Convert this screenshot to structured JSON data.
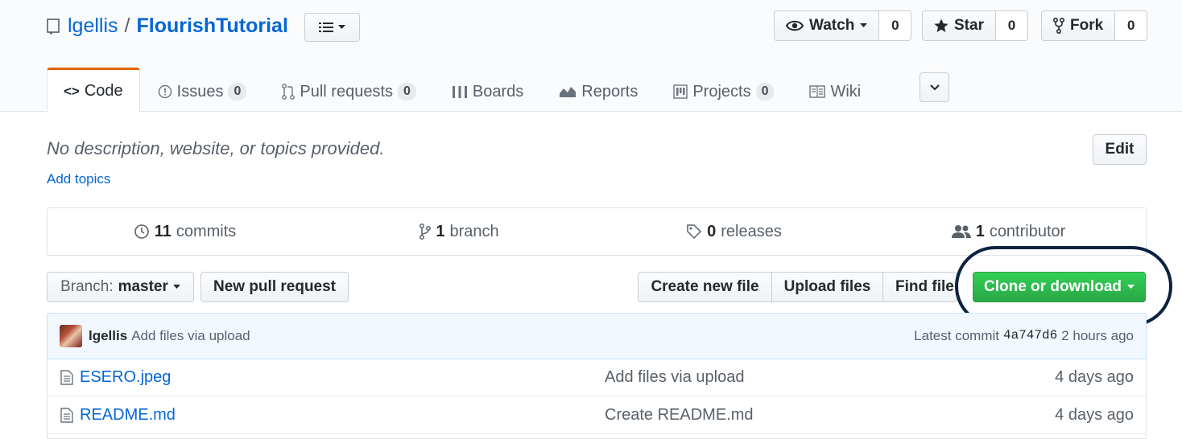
{
  "repo": {
    "owner": "lgellis",
    "separator": "/",
    "name": "FlourishTutorial"
  },
  "actions": {
    "watch": {
      "label": "Watch",
      "count": "0"
    },
    "star": {
      "label": "Star",
      "count": "0"
    },
    "fork": {
      "label": "Fork",
      "count": "0"
    }
  },
  "tabs": [
    {
      "label": "Code",
      "icon": "code-icon"
    },
    {
      "label": "Issues",
      "count": "0",
      "icon": "issue-icon"
    },
    {
      "label": "Pull requests",
      "count": "0",
      "icon": "pull-request-icon"
    },
    {
      "label": "Boards",
      "icon": "boards-icon"
    },
    {
      "label": "Reports",
      "icon": "graph-icon"
    },
    {
      "label": "Projects",
      "count": "0",
      "icon": "project-icon"
    },
    {
      "label": "Wiki",
      "icon": "book-icon"
    }
  ],
  "description": "No description, website, or topics provided.",
  "add_topics": "Add topics",
  "edit_label": "Edit",
  "summary": {
    "commits": {
      "count": "11",
      "label": "commits"
    },
    "branches": {
      "count": "1",
      "label": "branch"
    },
    "releases": {
      "count": "0",
      "label": "releases"
    },
    "contributors": {
      "count": "1",
      "label": "contributor"
    }
  },
  "branch": {
    "prefix": "Branch:",
    "name": "master"
  },
  "buttons": {
    "new_pr": "New pull request",
    "create_file": "Create new file",
    "upload": "Upload files",
    "find": "Find file",
    "clone": "Clone or download"
  },
  "commit": {
    "author": "lgellis",
    "message": "Add files via upload",
    "latest_label": "Latest commit",
    "sha": "4a747d6",
    "age": "2 hours ago"
  },
  "files": [
    {
      "name": "ESERO.jpeg",
      "message": "Add files via upload",
      "age": "4 days ago"
    },
    {
      "name": "README.md",
      "message": "Create README.md",
      "age": "4 days ago"
    }
  ],
  "colors": {
    "accent": "#0366d6",
    "clone_green": "#28a745",
    "selected_tab": "#e36209",
    "highlight_ring": "#0d2240"
  }
}
